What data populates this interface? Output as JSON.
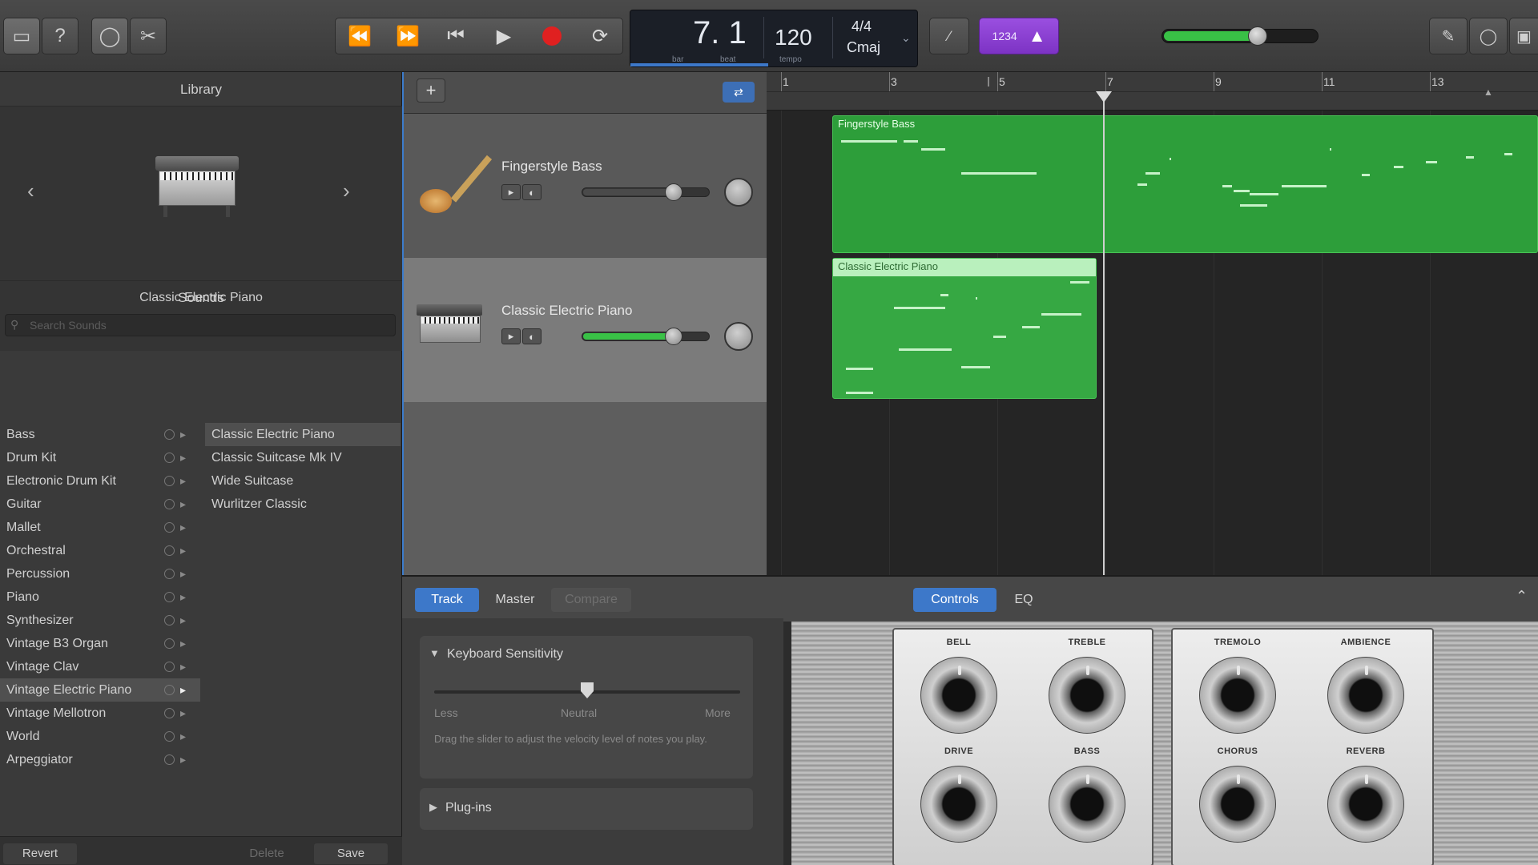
{
  "toolbar": {
    "lcd": {
      "position": "7. 1",
      "bar_label": "bar",
      "beat_label": "beat",
      "tempo": "120",
      "tempo_label": "tempo",
      "signature": "4/4",
      "key": "Cmaj"
    },
    "count_in": "1234",
    "icons": [
      "library-icon",
      "help-icon",
      "smart-controls-icon",
      "editors-icon",
      "rewind-icon",
      "fast-forward-icon",
      "go-to-start-icon",
      "play-icon",
      "record-icon",
      "cycle-icon",
      "tuner-icon",
      "metronome-icon",
      "notepad-icon",
      "loop-browser-icon",
      "media-browser-icon"
    ],
    "master_volume": 0.62,
    "colors": {
      "record": "#e02020",
      "count_in": "#8a3fd1",
      "region_green": "#2d9e3a"
    }
  },
  "library": {
    "title": "Library",
    "selected_patch": "Classic Electric Piano",
    "sounds_header": "Sounds",
    "search_placeholder": "Search Sounds",
    "categories": [
      "Bass",
      "Drum Kit",
      "Electronic Drum Kit",
      "Guitar",
      "Mallet",
      "Orchestral",
      "Percussion",
      "Piano",
      "Synthesizer",
      "Vintage B3 Organ",
      "Vintage Clav",
      "Vintage Electric Piano",
      "Vintage Mellotron",
      "World",
      "Arpeggiator"
    ],
    "selected_category": "Vintage Electric Piano",
    "sounds": [
      "Classic Electric Piano",
      "Classic Suitcase Mk IV",
      "Wide Suitcase",
      "Wurlitzer Classic"
    ],
    "footer": {
      "revert": "Revert",
      "delete": "Delete",
      "save": "Save"
    }
  },
  "tracks": [
    {
      "name": "Fingerstyle Bass",
      "volume": 0.72
    },
    {
      "name": "Classic Electric Piano",
      "volume": 0.72
    }
  ],
  "ruler": [
    "1",
    "3",
    "5",
    "7",
    "9",
    "11",
    "13"
  ],
  "regions": [
    {
      "name": "Fingerstyle Bass"
    },
    {
      "name": "Classic Electric Piano"
    }
  ],
  "smart_controls": {
    "tabs": [
      "Track",
      "Master",
      "Compare"
    ],
    "view_tabs": [
      "Controls",
      "EQ"
    ],
    "keyboard_sensitivity": {
      "title": "Keyboard Sensitivity",
      "less": "Less",
      "neutral": "Neutral",
      "more": "More",
      "help": "Drag the slider to adjust the velocity level of notes you play.",
      "value": 0.5
    },
    "plugins_label": "Plug-ins",
    "knobs_left": [
      "BELL",
      "TREBLE",
      "DRIVE",
      "BASS"
    ],
    "knobs_right": [
      "TREMOLO",
      "AMBIENCE",
      "CHORUS",
      "REVERB"
    ]
  }
}
